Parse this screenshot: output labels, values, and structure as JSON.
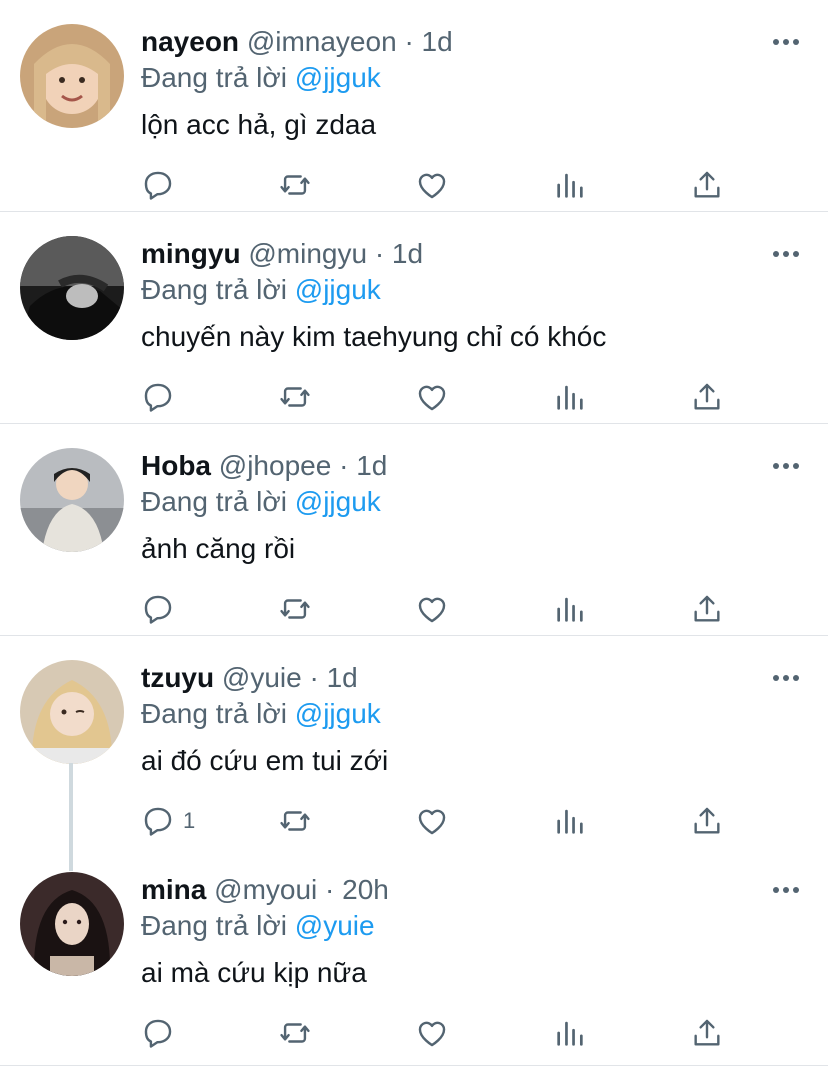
{
  "reply_prefix": "Đang trả lời",
  "colors": {
    "accent": "#1d9bf0",
    "secondary": "#536471",
    "divider": "#e1e4e8"
  },
  "tweets": [
    {
      "name": "nayeon",
      "handle": "@imnayeon",
      "dot": "·",
      "time": "1d",
      "reply_to": "@jjguk",
      "text": "lộn acc hả, gì zdaa",
      "reply_count": "",
      "avatar_icon": "avatar-photo"
    },
    {
      "name": "mingyu",
      "handle": "@mingyu",
      "dot": "·",
      "time": "1d",
      "reply_to": "@jjguk",
      "text": "chuyến này kim taehyung chỉ có khóc",
      "reply_count": "",
      "avatar_icon": "avatar-photo"
    },
    {
      "name": "Hoba",
      "handle": "@jhopee",
      "dot": "·",
      "time": "1d",
      "reply_to": "@jjguk",
      "text": "ảnh căng rồi",
      "reply_count": "",
      "avatar_icon": "avatar-photo"
    },
    {
      "name": "tzuyu",
      "handle": "@yuie",
      "dot": "·",
      "time": "1d",
      "reply_to": "@jjguk",
      "text": "ai đó cứu em tui zới",
      "reply_count": "1",
      "avatar_icon": "avatar-photo"
    },
    {
      "name": "mina",
      "handle": "@myoui",
      "dot": "·",
      "time": "20h",
      "reply_to": "@yuie",
      "text": "ai mà cứu kịp nữa",
      "reply_count": "",
      "avatar_icon": "avatar-photo"
    }
  ]
}
